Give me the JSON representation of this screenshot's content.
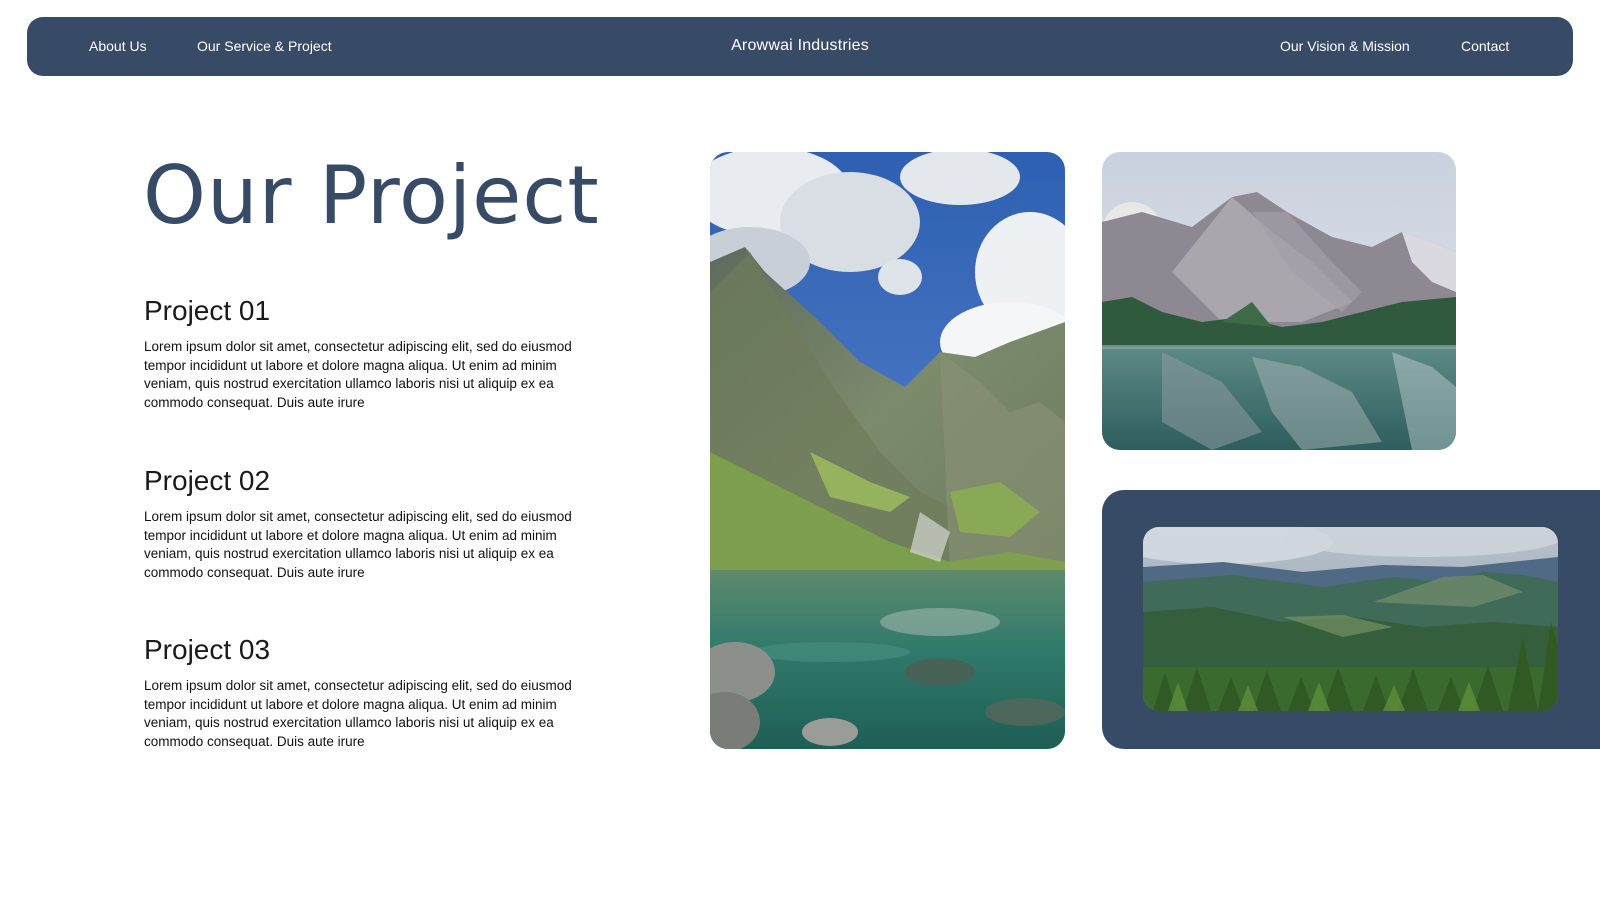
{
  "nav": {
    "about": "About Us",
    "service": "Our Service & Project",
    "brand": "Arowwai Industries",
    "vision": "Our Vision & Mission",
    "contact": "Contact"
  },
  "main": {
    "title": "Our Project",
    "projects": [
      {
        "heading": "Project 01",
        "body": "Lorem ipsum dolor sit amet, consectetur adipiscing elit, sed do eiusmod tempor incididunt ut labore et dolore magna aliqua. Ut enim ad minim veniam, quis nostrud exercitation ullamco laboris nisi ut aliquip ex ea commodo consequat. Duis aute irure"
      },
      {
        "heading": "Project 02",
        "body": "Lorem ipsum dolor sit amet, consectetur adipiscing elit, sed do eiusmod tempor incididunt ut labore et dolore magna aliqua. Ut enim ad minim veniam, quis nostrud exercitation ullamco laboris nisi ut aliquip ex ea commodo consequat. Duis aute irure"
      },
      {
        "heading": "Project 03",
        "body": "Lorem ipsum dolor sit amet, consectetur adipiscing elit, sed do eiusmod tempor incididunt ut labore et dolore magna aliqua. Ut enim ad minim veniam, quis nostrud exercitation ullamco laboris nisi ut aliquip ex ea commodo consequat. Duis aute irure"
      }
    ]
  },
  "colors": {
    "brand_navy": "#384b66",
    "text_dark": "#111111",
    "background": "#ffffff"
  }
}
